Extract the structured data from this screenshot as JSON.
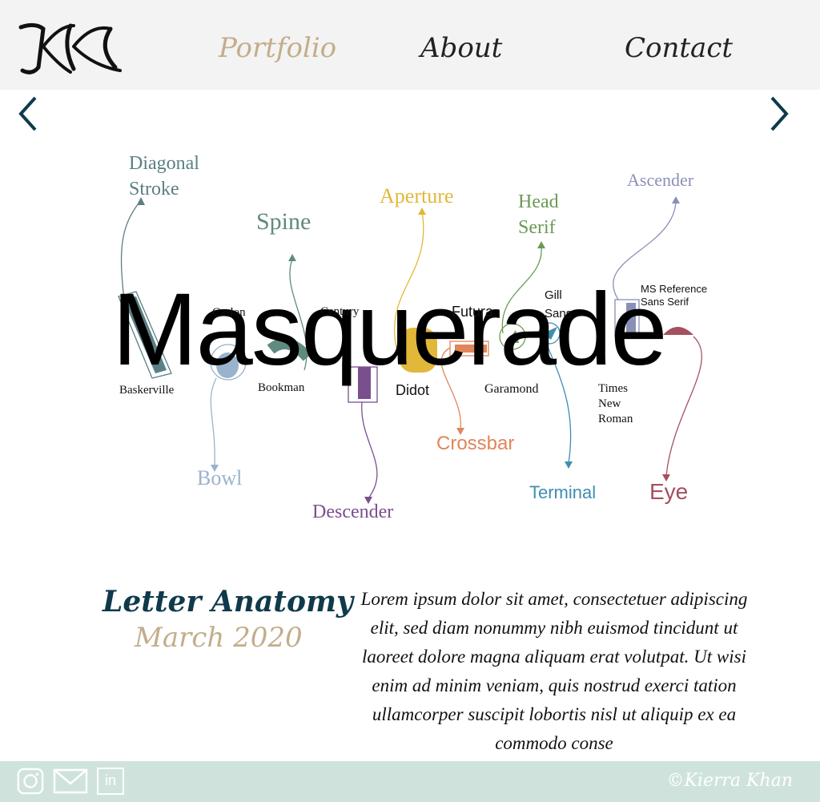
{
  "header": {
    "logo_icon": "kk-monogram-logo",
    "nav": {
      "portfolio": "Portfolio",
      "about": "About",
      "contact": "Contact"
    }
  },
  "hero": {
    "word": "Masquerade",
    "labels": {
      "diagonal_stroke": [
        "Diagonal",
        "Stroke"
      ],
      "spine": "Spine",
      "aperture": "Aperture",
      "head_serif": [
        "Head",
        "Serif"
      ],
      "ascender": "Ascender",
      "bowl": "Bowl",
      "descender": "Descender",
      "crossbar": "Crossbar",
      "terminal": "Terminal",
      "eye": "Eye"
    },
    "fonts": {
      "caslon": "Caslon",
      "century": "Century",
      "futura": "Futura",
      "gill_sans": [
        "Gill",
        "Sans"
      ],
      "ms_reference": [
        "MS Reference",
        "Sans Serif"
      ],
      "baskerville": "Baskerville",
      "bookman": "Bookman",
      "didot": "Didot",
      "garamond": "Garamond",
      "times": [
        "Times",
        "New",
        "Roman"
      ]
    },
    "colors": {
      "diagonal_stroke": "#5a7f84",
      "spine": "#5f8a80",
      "aperture": "#e2b83a",
      "head_serif": "#6a9a55",
      "ascender": "#8a8fb8",
      "bowl": "#9ab3cc",
      "descender": "#7a4f8e",
      "crossbar": "#e0865a",
      "terminal": "#3f8db1",
      "eye": "#a4505e"
    },
    "prev_icon": "chevron-left-icon",
    "next_icon": "chevron-right-icon"
  },
  "caption": {
    "title": "Letter Anatomy",
    "date": "March 2020",
    "body": "Lorem ipsum dolor sit amet, consectetuer adipiscing elit, sed diam nonummy nibh euismod tincidunt ut laoreet dolore magna aliquam erat volutpat. Ut wisi enim ad minim veniam, quis nostrud exerci tation ullamcorper suscipit lobortis nisl ut aliquip ex ea commodo conse"
  },
  "footer": {
    "social_icons": [
      "instagram-icon",
      "mail-icon",
      "linkedin-icon"
    ],
    "linkedin_text": "in",
    "copyright": "©Kierra Khan"
  }
}
